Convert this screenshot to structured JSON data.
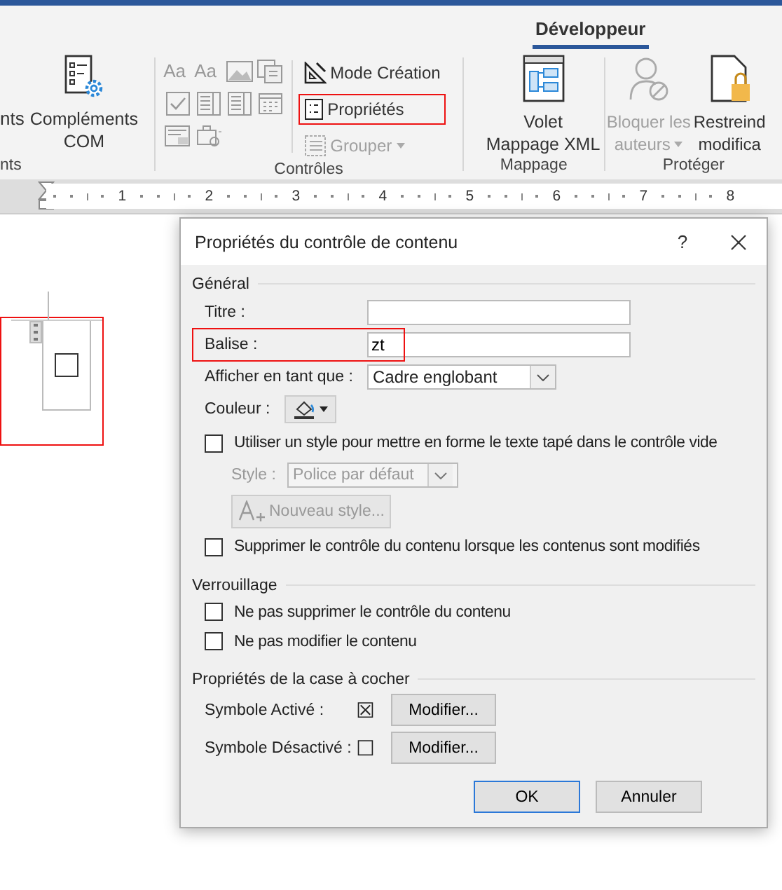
{
  "ribbon": {
    "tab": {
      "label": "Développeur",
      "selected": true
    },
    "groups": [
      {
        "kind": "addins",
        "label": "nts",
        "cut_button": "nts",
        "button": {
          "lines": [
            "Compléments",
            "COM"
          ]
        }
      },
      {
        "kind": "controls",
        "label": "Contrôles",
        "gallery": [
          {
            "kind": "text",
            "label": "Aa"
          },
          {
            "kind": "text",
            "label": "Aa"
          },
          {
            "kind": "image"
          },
          {
            "kind": "blocks"
          },
          {
            "kind": "checkbox"
          },
          {
            "kind": "combo"
          },
          {
            "kind": "list"
          },
          {
            "kind": "date"
          },
          {
            "kind": "legacy"
          },
          {
            "kind": "tools"
          }
        ],
        "commands": [
          {
            "kind": "design",
            "label": "Mode Création",
            "disabled": false,
            "highlighted": false
          },
          {
            "kind": "properties",
            "label": "Propriétés",
            "disabled": false,
            "highlighted": true
          },
          {
            "kind": "group",
            "label": "Grouper",
            "disabled": true,
            "highlighted": false
          }
        ]
      },
      {
        "kind": "mapping",
        "label": "Mappage",
        "button": {
          "lines": [
            "Volet",
            "Mappage XML"
          ]
        }
      },
      {
        "kind": "protect",
        "label": "Protéger",
        "buttons": [
          {
            "lines": [
              "Bloquer les",
              "auteurs"
            ],
            "disabled": true
          },
          {
            "lines": [
              "Restreind",
              "modifica"
            ],
            "disabled": false
          }
        ]
      }
    ]
  },
  "ruler": {
    "marks": [
      "1",
      "2",
      "3",
      "4",
      "5",
      "6",
      "7",
      "8"
    ]
  },
  "document": {
    "content_control": {
      "checked": false,
      "highlighted": true
    }
  },
  "dialog": {
    "title": "Propriétés du contrôle de contenu",
    "help": "?",
    "general": {
      "heading": "Général",
      "title_field": {
        "label": "Titre :"
      },
      "tag_field": {
        "label": "Balise :",
        "value": "zt",
        "highlighted": true
      },
      "show_as": {
        "label": "Afficher en tant que :",
        "value": "Cadre englobant"
      },
      "color": {
        "label": "Couleur :"
      },
      "use_style": {
        "label": "Utiliser un style pour mettre en forme le texte tapé dans le contrôle vide",
        "checked": false
      },
      "style": {
        "label": "Style :",
        "value": "Police par défaut",
        "disabled": true
      },
      "new_style": {
        "label": "Nouveau style...",
        "disabled": true
      },
      "remove_on_edit": {
        "label": "Supprimer le contrôle du contenu lorsque les contenus sont modifiés",
        "checked": false
      }
    },
    "locking": {
      "heading": "Verrouillage",
      "options": [
        {
          "label": "Ne pas supprimer le contrôle du contenu",
          "checked": false
        },
        {
          "label": "Ne pas modifier le contenu",
          "checked": false
        }
      ]
    },
    "checkbox_props": {
      "heading": "Propriétés de la case à cocher",
      "rows": [
        {
          "label": "Symbole Activé :",
          "symbol": "☒",
          "button": "Modifier..."
        },
        {
          "label": "Symbole Désactivé :",
          "symbol": "☐",
          "button": "Modifier..."
        }
      ]
    },
    "buttons": [
      {
        "label": "OK",
        "default": true
      },
      {
        "label": "Annuler",
        "default": false
      }
    ]
  }
}
